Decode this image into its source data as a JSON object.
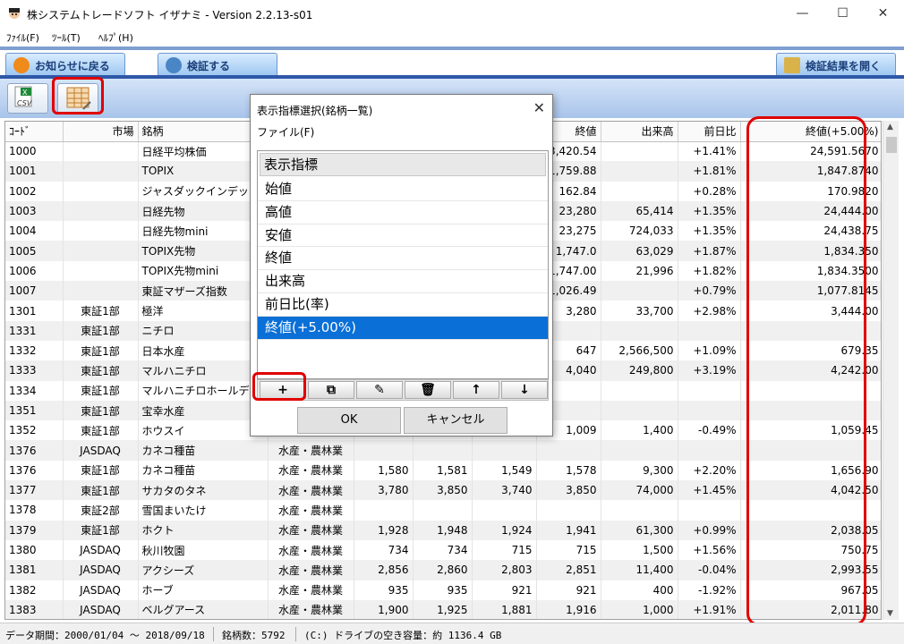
{
  "window": {
    "title": "株システムトレードソフト イザナミ - Version 2.2.13-s01"
  },
  "menu": [
    "ﾌｧｲﾙ(F)",
    "ﾂｰﾙ(T)",
    "ﾍﾙﾌﾟ(H)"
  ],
  "tabs": {
    "back": "お知らせに戻る",
    "verify": "検証する",
    "open_results": "検証結果を開く"
  },
  "grid": {
    "columns": [
      "ｺｰﾄﾞ",
      "市場",
      "銘柄",
      "",
      "",
      "",
      "",
      "終値",
      "出来高",
      "前日比",
      "終値(+5.00%)"
    ],
    "rows": [
      [
        "1000",
        "",
        "日経平均株価",
        "",
        "",
        "",
        "",
        "23,420.54",
        "",
        "+1.41%",
        "24,591.5670"
      ],
      [
        "1001",
        "",
        "TOPIX",
        "",
        "",
        "",
        "",
        "1,759.88",
        "",
        "+1.81%",
        "1,847.8740"
      ],
      [
        "1002",
        "",
        "ジャスダックインデックス",
        "",
        "",
        "",
        "",
        "162.84",
        "",
        "+0.28%",
        "170.9820"
      ],
      [
        "1003",
        "",
        "日経先物",
        "",
        "",
        "",
        "",
        "23,280",
        "65,414",
        "+1.35%",
        "24,444.00"
      ],
      [
        "1004",
        "",
        "日経先物mini",
        "",
        "",
        "",
        "",
        "23,275",
        "724,033",
        "+1.35%",
        "24,438.75"
      ],
      [
        "1005",
        "",
        "TOPIX先物",
        "",
        "",
        "",
        "",
        "1,747.0",
        "63,029",
        "+1.87%",
        "1,834.350"
      ],
      [
        "1006",
        "",
        "TOPIX先物mini",
        "",
        "",
        "",
        "",
        "1,747.00",
        "21,996",
        "+1.82%",
        "1,834.3500"
      ],
      [
        "1007",
        "",
        "東証マザーズ指数",
        "",
        "",
        "",
        "",
        "1,026.49",
        "",
        "+0.79%",
        "1,077.8145"
      ],
      [
        "1301",
        "東証1部",
        "極洋",
        "",
        "",
        "",
        "",
        "3,280",
        "33,700",
        "+2.98%",
        "3,444.00"
      ],
      [
        "1331",
        "東証1部",
        "ニチロ",
        "",
        "",
        "",
        "",
        "",
        "",
        "",
        ""
      ],
      [
        "1332",
        "東証1部",
        "日本水産",
        "",
        "",
        "",
        "",
        "647",
        "2,566,500",
        "+1.09%",
        "679.35"
      ],
      [
        "1333",
        "東証1部",
        "マルハニチロ",
        "",
        "",
        "",
        "",
        "4,040",
        "249,800",
        "+3.19%",
        "4,242.00"
      ],
      [
        "1334",
        "東証1部",
        "マルハニチロホールデ...",
        "",
        "",
        "",
        "",
        "",
        "",
        "",
        ""
      ],
      [
        "1351",
        "東証1部",
        "宝幸水産",
        "",
        "",
        "",
        "",
        "",
        "",
        "",
        ""
      ],
      [
        "1352",
        "東証1部",
        "ホウスイ",
        "",
        "",
        "",
        "",
        "1,009",
        "1,400",
        "-0.49%",
        "1,059.45"
      ],
      [
        "1376",
        "JASDAQ",
        "カネコ種苗",
        "水産・農林業",
        "",
        "",
        "",
        "",
        "",
        "",
        ""
      ],
      [
        "1376",
        "東証1部",
        "カネコ種苗",
        "水産・農林業",
        "1,580",
        "1,581",
        "1,549",
        "1,578",
        "9,300",
        "+2.20%",
        "1,656.90"
      ],
      [
        "1377",
        "東証1部",
        "サカタのタネ",
        "水産・農林業",
        "3,780",
        "3,850",
        "3,740",
        "3,850",
        "74,000",
        "+1.45%",
        "4,042.50"
      ],
      [
        "1378",
        "東証2部",
        "雪国まいたけ",
        "水産・農林業",
        "",
        "",
        "",
        "",
        "",
        "",
        ""
      ],
      [
        "1379",
        "東証1部",
        "ホクト",
        "水産・農林業",
        "1,928",
        "1,948",
        "1,924",
        "1,941",
        "61,300",
        "+0.99%",
        "2,038.05"
      ],
      [
        "1380",
        "JASDAQ",
        "秋川牧園",
        "水産・農林業",
        "734",
        "734",
        "715",
        "715",
        "1,500",
        "+1.56%",
        "750.75"
      ],
      [
        "1381",
        "JASDAQ",
        "アクシーズ",
        "水産・農林業",
        "2,856",
        "2,860",
        "2,803",
        "2,851",
        "11,400",
        "-0.04%",
        "2,993.55"
      ],
      [
        "1382",
        "JASDAQ",
        "ホーブ",
        "水産・農林業",
        "935",
        "935",
        "921",
        "921",
        "400",
        "-1.92%",
        "967.05"
      ],
      [
        "1383",
        "JASDAQ",
        "ベルグアース",
        "水産・農林業",
        "1,900",
        "1,925",
        "1,881",
        "1,916",
        "1,000",
        "+1.91%",
        "2,011.80"
      ]
    ]
  },
  "dialog": {
    "title": "表示指標選択(銘柄一覧)",
    "menu": "ファイル(F)",
    "list_header": "表示指標",
    "items": [
      "始値",
      "高値",
      "安値",
      "終値",
      "出来高",
      "前日比(率)",
      "終値(+5.00%)"
    ],
    "selected_index": 6,
    "tools": [
      "+",
      "⧉",
      "✎",
      "🗑",
      "↑",
      "↓"
    ],
    "ok": "OK",
    "cancel": "キャンセル"
  },
  "status": {
    "period": "データ期間：2000/01/04 ～ 2018/09/18",
    "count": "銘柄数：5792",
    "disk": "(C:) ドライブの空き容量：約 1136.4 GB"
  }
}
